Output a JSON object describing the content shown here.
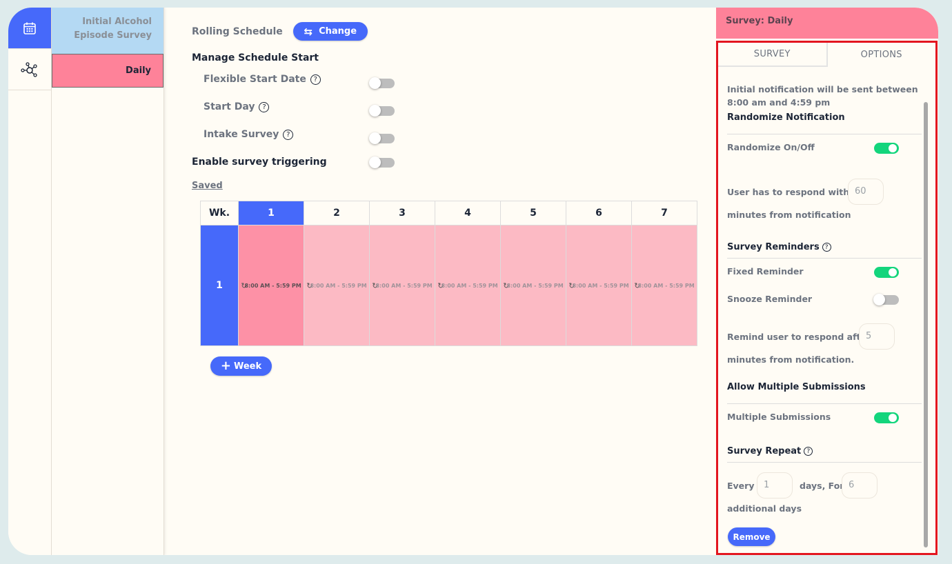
{
  "rail": {
    "items": [
      {
        "name": "calendar",
        "active": true
      },
      {
        "name": "network",
        "active": false
      }
    ]
  },
  "surveys": [
    {
      "label": "Initial Alcohol Episode Survey",
      "color": "#b4d9f3"
    },
    {
      "label": "Daily",
      "color": "#fe8299",
      "selected": true
    }
  ],
  "main": {
    "schedule_type_label": "Rolling Schedule",
    "change_button": "Change",
    "manage_heading": "Manage Schedule Start",
    "options": [
      {
        "label": "Flexible Start Date",
        "help": true,
        "enabled": false
      },
      {
        "label": "Start Day",
        "help": true,
        "enabled": false
      },
      {
        "label": "Intake Survey",
        "help": true,
        "enabled": false
      }
    ],
    "triggering_label": "Enable survey triggering",
    "triggering_enabled": false,
    "saved_label": "Saved",
    "help_glyph": "?",
    "table": {
      "week_header": "Wk.",
      "days": [
        "1",
        "2",
        "3",
        "4",
        "5",
        "6",
        "7"
      ],
      "selected_day": "1",
      "weeks": [
        {
          "week": "1",
          "cells": [
            "8:00 AM - 5:59 PM",
            "8:00 AM - 5:59 PM",
            "8:00 AM - 5:59 PM",
            "8:00 AM - 5:59 PM",
            "8:00 AM - 5:59 PM",
            "8:00 AM - 5:59 PM",
            "8:00 AM - 5:59 PM"
          ]
        }
      ]
    },
    "add_week_button": "Week"
  },
  "panel": {
    "title": "Survey: Daily",
    "tabs": [
      {
        "label": "SURVEY",
        "active": false
      },
      {
        "label": "OPTIONS",
        "active": true
      }
    ],
    "notification_info": "Initial notification will be sent between 8:00 am and 4:59 pm",
    "randomize": {
      "heading": "Randomize Notification",
      "toggle_label": "Randomize On/Off",
      "enabled": true,
      "respond_prefix": "User has to respond within",
      "respond_value": "60",
      "respond_suffix": "minutes from notification"
    },
    "reminders": {
      "heading": "Survey Reminders",
      "fixed_label": "Fixed Reminder",
      "fixed_enabled": true,
      "snooze_label": "Snooze Reminder",
      "snooze_enabled": false,
      "remind_prefix": "Remind user to respond after",
      "remind_value": "5",
      "remind_suffix": "minutes from notification."
    },
    "multiple": {
      "heading": "Allow Multiple Submissions",
      "toggle_label": "Multiple Submissions",
      "enabled": true
    },
    "repeat": {
      "heading": "Survey Repeat",
      "every_label": "Every",
      "every_value": "1",
      "days_for_label": "days, For",
      "for_value": "6",
      "additional_label": "additional days"
    },
    "remove_button": "Remove"
  },
  "colors": {
    "accent": "#4669fa",
    "toggle_on": "#13d57c",
    "survey_daily": "#fe8299",
    "highlight_frame": "#e3151f"
  }
}
